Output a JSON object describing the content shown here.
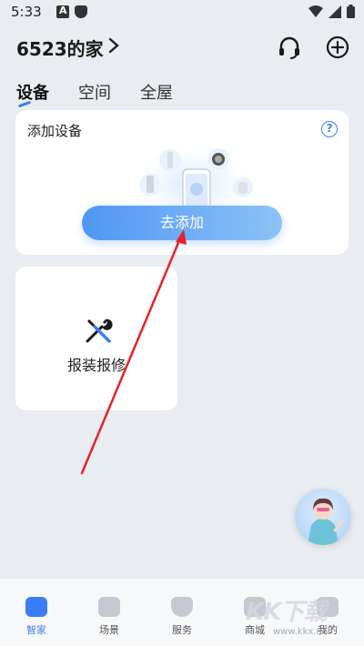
{
  "status_bar": {
    "time": "5:33"
  },
  "header": {
    "home_name": "6523的家"
  },
  "tabs": [
    {
      "label": "设备",
      "active": true
    },
    {
      "label": "空间",
      "active": false
    },
    {
      "label": "全屋",
      "active": false
    }
  ],
  "add_device_card": {
    "title": "添加设备",
    "help_label": "?",
    "button_label": "去添加"
  },
  "repair_card": {
    "label": "报装报修"
  },
  "bottom_nav": [
    {
      "label": "智家",
      "active": true
    },
    {
      "label": "场景",
      "active": false
    },
    {
      "label": "服务",
      "active": false
    },
    {
      "label": "商城",
      "active": false
    },
    {
      "label": "我的",
      "active": false
    }
  ],
  "watermark": {
    "text": "KK下载",
    "sub": "www.kkx.net"
  },
  "colors": {
    "accent": "#3a7df6",
    "arrow": "#e8212a",
    "background": "#e9ecf0"
  }
}
